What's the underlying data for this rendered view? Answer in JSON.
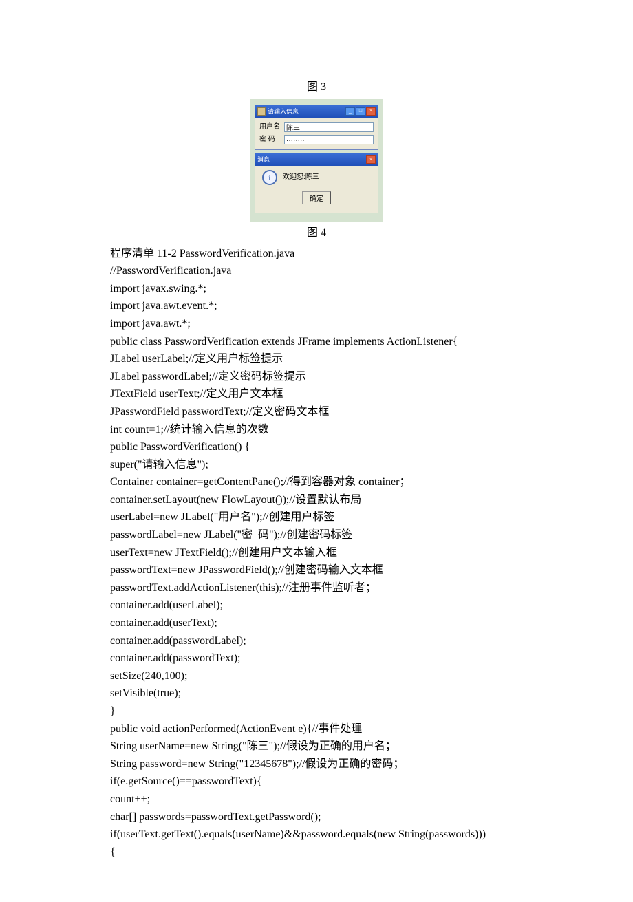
{
  "captions": {
    "fig3": "图 3",
    "fig4": "图 4"
  },
  "dialog1": {
    "title": "请输入信息",
    "userLabelText": "用户名",
    "userValue": "陈三",
    "passLabelText": "密  码",
    "passValue": "········"
  },
  "dialog2": {
    "title": "消息",
    "message": "欢迎您:陈三",
    "okLabel": "确定"
  },
  "code": {
    "listingTitle": "程序清单  11-2    PasswordVerification.java",
    "lines": [
      "//PasswordVerification.java",
      "import javax.swing.*;",
      "import java.awt.event.*;",
      "import java.awt.*;",
      "public class PasswordVerification extends JFrame implements ActionListener{",
      "JLabel userLabel;//定义用户标签提示",
      "JLabel passwordLabel;//定义密码标签提示",
      "JTextField userText;//定义用户文本框",
      "JPasswordField passwordText;//定义密码文本框",
      "int count=1;//统计输入信息的次数",
      "public PasswordVerification() {",
      "super(\"请输入信息\");",
      "Container container=getContentPane();//得到容器对象 container；",
      "container.setLayout(new FlowLayout());//设置默认布局",
      "userLabel=new JLabel(\"用户名\");//创建用户标签",
      "passwordLabel=new JLabel(\"密  码\");//创建密码标签",
      "userText=new JTextField();//创建用户文本输入框",
      "passwordText=new JPasswordField();//创建密码输入文本框",
      "passwordText.addActionListener(this);//注册事件监听者；",
      "container.add(userLabel);",
      "container.add(userText);",
      "container.add(passwordLabel);",
      "container.add(passwordText);",
      "setSize(240,100);",
      "setVisible(true);",
      "}",
      "public void actionPerformed(ActionEvent e){//事件处理",
      "String userName=new String(\"陈三\");//假设为正确的用户名；",
      "String password=new String(\"12345678\");//假设为正确的密码；",
      "if(e.getSource()==passwordText){",
      "count++;",
      "char[] passwords=passwordText.getPassword();",
      "if(userText.getText().equals(userName)&&password.equals(new String(passwords)))",
      "{"
    ]
  }
}
